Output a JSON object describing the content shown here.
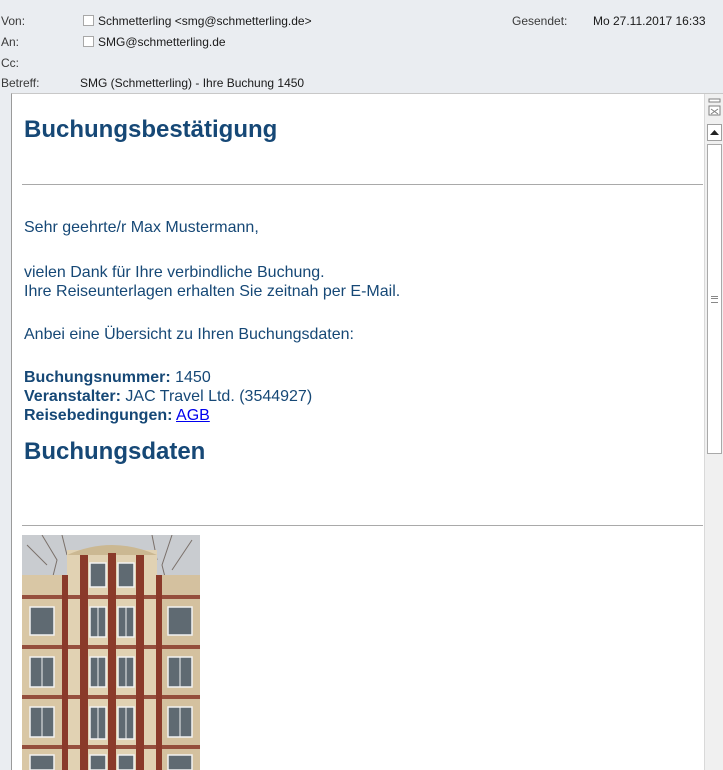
{
  "header": {
    "from_label": "Von:",
    "from_value": "Schmetterling <smg@schmetterling.de>",
    "to_label": "An:",
    "to_value": "SMG@schmetterling.de",
    "cc_label": "Cc:",
    "subject_label": "Betreff:",
    "subject_value": "SMG (Schmetterling) - Ihre Buchung 1450",
    "sent_label": "Gesendet:",
    "sent_value": "Mo 27.11.2017 16:33"
  },
  "email": {
    "title": "Buchungsbestätigung",
    "greeting": "Sehr geehrte/r Max Mustermann,",
    "thanks_line1": "vielen Dank für Ihre verbindliche Buchung.",
    "thanks_line2": "Ihre Reiseunterlagen erhalten Sie zeitnah per E-Mail.",
    "overview_intro": "Anbei eine Übersicht zu Ihren Buchungsdaten:",
    "booking_number_label": "Buchungsnummer:",
    "booking_number_value": "1450",
    "organizer_label": "Veranstalter:",
    "organizer_value": "JAC Travel Ltd. (3544927)",
    "terms_label": "Reisebedingungen:",
    "terms_link": "AGB",
    "section_title": "Buchungsdaten"
  },
  "colors": {
    "heading": "#164876",
    "link": "#0000ee",
    "header_bg": "#eaedf1"
  },
  "icons": {
    "scroll_top": "collapse-icon",
    "scroll_up": "arrow-up-icon",
    "thumb_grip": "grip-icon"
  }
}
